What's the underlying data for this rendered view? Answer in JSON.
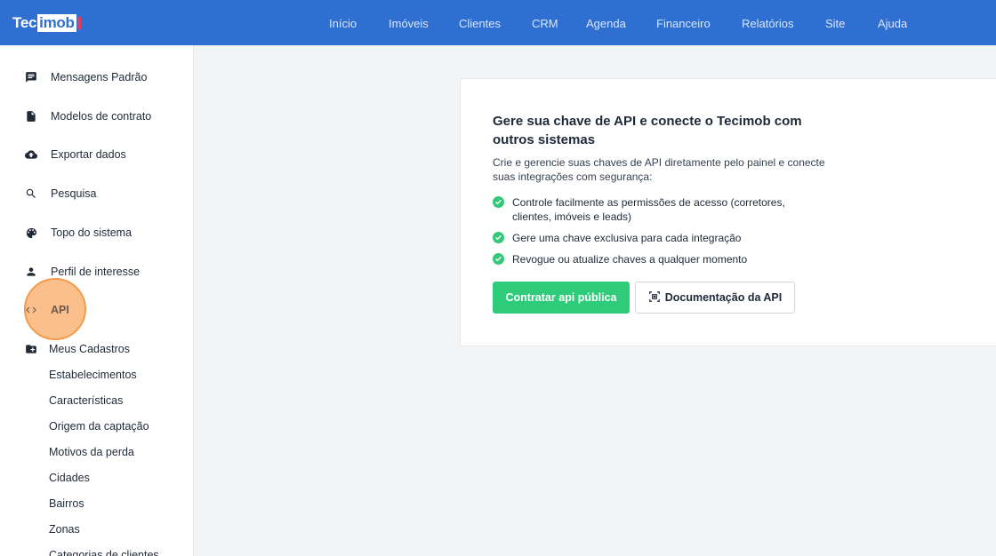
{
  "logo": {
    "part1": "Tec",
    "part2": "imob"
  },
  "nav": [
    {
      "label": "Início"
    },
    {
      "label": "Imóveis"
    },
    {
      "label": "Clientes"
    },
    {
      "label": "CRM"
    },
    {
      "label": "Agenda"
    },
    {
      "label": "Financeiro"
    },
    {
      "label": "Relatórios"
    },
    {
      "label": "Site"
    },
    {
      "label": "Ajuda"
    }
  ],
  "sidebar": {
    "items": [
      {
        "label": "Mensagens Padrão",
        "icon": "message-icon"
      },
      {
        "label": "Modelos de contrato",
        "icon": "document-icon"
      },
      {
        "label": "Exportar dados",
        "icon": "cloud-upload-icon"
      },
      {
        "label": "Pesquisa",
        "icon": "search-icon"
      },
      {
        "label": "Topo do sistema",
        "icon": "palette-icon"
      },
      {
        "label": "Perfil de interesse",
        "icon": "person-icon"
      },
      {
        "label": "API",
        "icon": "code-icon"
      }
    ],
    "group": {
      "label": "Meus Cadastros",
      "icon": "folder-add-icon"
    },
    "subitems": [
      {
        "label": "Estabelecimentos"
      },
      {
        "label": "Características"
      },
      {
        "label": "Origem da captação"
      },
      {
        "label": "Motivos da perda"
      },
      {
        "label": "Cidades"
      },
      {
        "label": "Bairros"
      },
      {
        "label": "Zonas"
      },
      {
        "label": "Categorias de clientes"
      }
    ]
  },
  "card": {
    "title": "Gere sua chave de API e conecte o Tecimob com outros sistemas",
    "description": "Crie e gerencie suas chaves de API diretamente pelo painel e conecte suas integrações com segurança:",
    "features": [
      {
        "text": "Controle facilmente as permissões de acesso (corretores, clientes, imóveis e leads)"
      },
      {
        "text": "Gere uma chave exclusiva para cada integração"
      },
      {
        "text": "Revogue ou atualize chaves a qualquer momento"
      }
    ],
    "primary_button": "Contratar api pública",
    "secondary_button": "Documentação da API"
  },
  "colors": {
    "topbar": "#2f6fd2",
    "accent_green": "#2ecc7a",
    "highlight": "#f49a4a"
  }
}
